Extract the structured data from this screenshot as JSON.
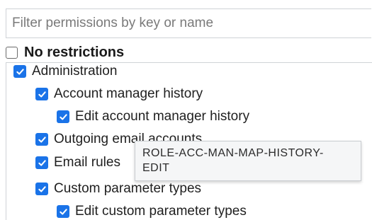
{
  "filter": {
    "placeholder": "Filter permissions by key or name",
    "value": ""
  },
  "no_restrictions": {
    "label": "No restrictions",
    "checked": false
  },
  "tree": {
    "items": [
      {
        "label": "Administration",
        "checked": true,
        "level": 0
      },
      {
        "label": "Account manager history",
        "checked": true,
        "level": 1
      },
      {
        "label": "Edit account manager history",
        "checked": true,
        "level": 2
      },
      {
        "label": "Outgoing email accounts",
        "checked": true,
        "level": 1
      },
      {
        "label": "Email rules",
        "checked": true,
        "level": 1
      },
      {
        "label": "Custom parameter types",
        "checked": true,
        "level": 1
      },
      {
        "label": "Edit custom parameter types",
        "checked": true,
        "level": 2
      }
    ]
  },
  "tooltip": {
    "line1": "ROLE-ACC-MAN-MAP-HISTORY-",
    "line2": "EDIT"
  },
  "colors": {
    "checkbox": "#1a73e8",
    "tooltip_bg": "#f5f6f7"
  }
}
